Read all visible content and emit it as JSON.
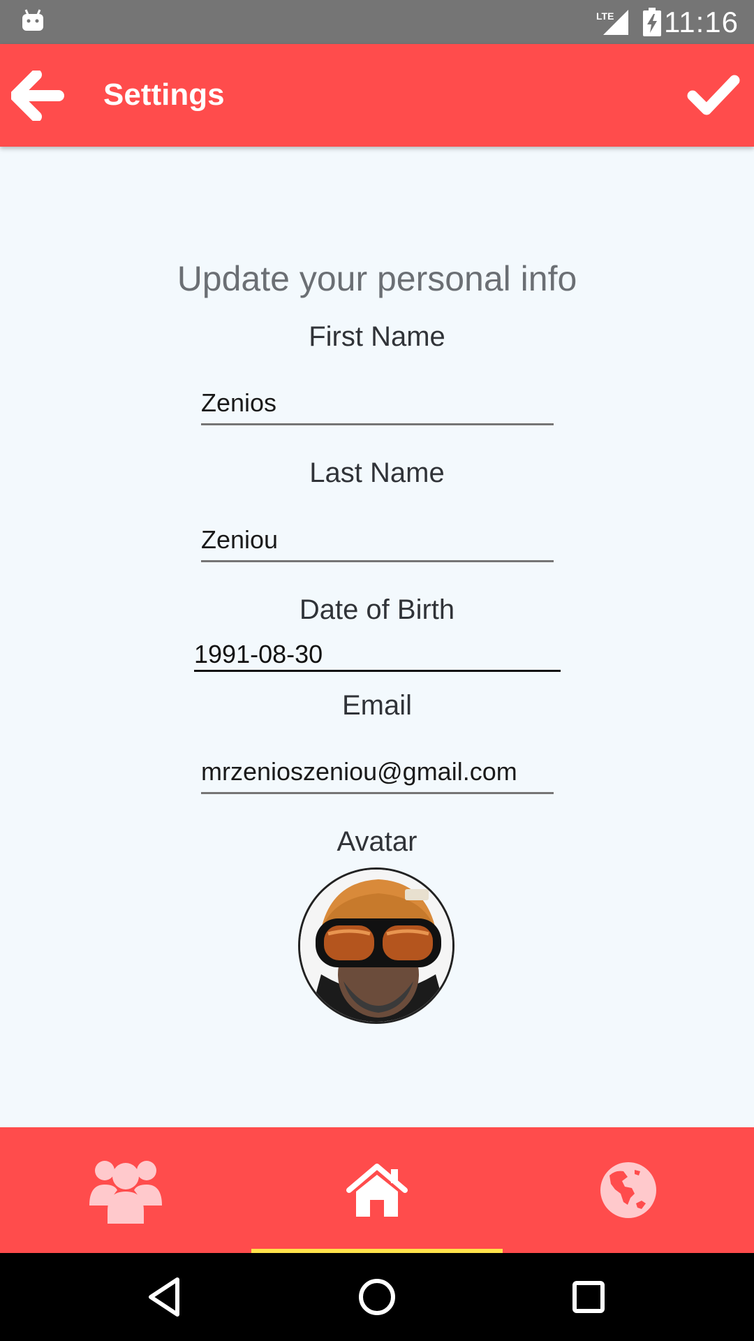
{
  "status_bar": {
    "time": "11:16",
    "network": "LTE",
    "notification_icon": "android-icon"
  },
  "app_bar": {
    "title": "Settings",
    "back_icon": "arrow-left-icon",
    "save_icon": "check-icon"
  },
  "form": {
    "heading": "Update your personal info",
    "first_name": {
      "label": "First Name",
      "value": "Zenios"
    },
    "last_name": {
      "label": "Last Name",
      "value": "Zeniou"
    },
    "date_of_birth": {
      "label": "Date of Birth",
      "value": "1991-08-30"
    },
    "email": {
      "label": "Email",
      "value": "mrzenioszeniou@gmail.com"
    },
    "avatar": {
      "label": "Avatar"
    }
  },
  "bottom_nav": {
    "items": [
      {
        "icon": "users-icon",
        "active": false
      },
      {
        "icon": "home-icon",
        "active": true
      },
      {
        "icon": "globe-icon",
        "active": false
      }
    ],
    "indicator_color": "#ffe24a"
  },
  "colors": {
    "primary": "#ff4c4c",
    "background": "#f3f9fd",
    "status_bar": "#757575"
  }
}
